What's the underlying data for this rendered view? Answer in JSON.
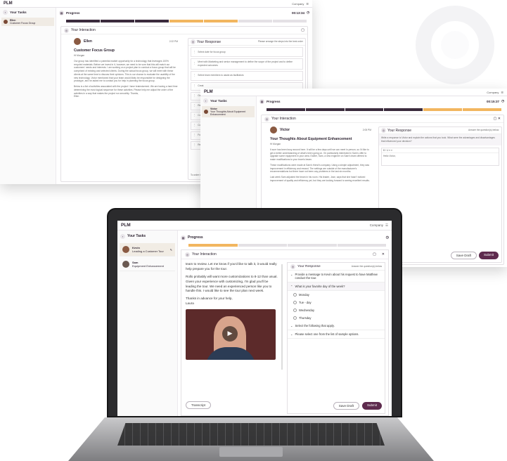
{
  "app_name": "PLM",
  "company_label": "Company",
  "colors": {
    "accent": "#5e2b4e",
    "progress_dark": "#3b2b3d",
    "progress_orange": "#f2b65f"
  },
  "win1": {
    "your_tasks": "Your Tasks",
    "task_name": "Ellen",
    "task_sub": "Customer Focus Group",
    "progress": "Progress",
    "timer": "00:13:34",
    "your_interaction": "Your Interaction",
    "sender": "Ellen",
    "time": "2:22 PM",
    "subject": "Customer Focus Group",
    "greeting": "Hi Morgan",
    "body1": "Our group has identified a potential market opportunity for a technology that leverages 100% recycled materials. Before we invest in it, however, we need to be sure that this will match our customers' needs and interests. I am working on a project plan to conduct a focus group that will be comprised of existing and selected clients. During the actual focus group, we will meet with these clients at the same time to discuss their opinions. This is our chance to evaluate the usability of the new technology. Victor mentioned that your team would likely be responsible for designing the prototype, and he asked me to contact you for help in planning the focus group.",
    "body2": "Below is a list of activities associated with the project I have brainstormed. We are having a hard time determining the most logical sequence for these activities. Please help me adjust the order of the activities in a way that makes the project run smoothly. Thanks,",
    "signoff": "Ellen",
    "your_response": "Your Response",
    "response_hint": "Please arrange the steps into the best order",
    "steps": [
      "Select date for focus group",
      "Meet with Marketing and senior management to define the scope of the project and to define expected outcomes",
      "Select team members to assist as facilitators",
      "Creat",
      "Gene",
      "Revie",
      "Condi",
      "Condi",
      "Follow",
      "Revie"
    ],
    "footer_note": "To order them bu"
  },
  "win2": {
    "your_tasks": "Your Tasks",
    "task_name": "Victor",
    "task_sub": "Your Thoughts About Equipment Enhancement",
    "progress": "Progress",
    "timer": "00:15:37",
    "your_interaction": "Your Interaction",
    "sender": "Victor",
    "time": "2:05 PM",
    "subject": "Your Thoughts About Equipment Enhancement",
    "greeting": "Hi Morgan",
    "body1": "It sure has been busy around here. It will be a few days until we can meet in person, so I'd like to get a better understanding of what's been going on. I'm particularly interested in Sam's offer to upgrade some equipment in your area. Earlier, Sam, a new engineer on Sam's team offered to make modifications to your team's beam.",
    "body2": "These modifications were made at Sam's friend's company. Using a simple adjustment, they saw improvement in efficiency and reward. The settings are outside of the manufacturer's recommendations but there have not been any problems in the last six months.",
    "body3": "Last week Sam adjusted the beam in his room. His leader, Jose, says that she hasn't noticed improvement of quality and efficiency yet, but they are looking forward to seeing excellent results.",
    "your_response": "Your Response",
    "response_hint": "Answer the question(s) below.",
    "question": "Write a response to Victor and explain the actions that you took. What were the advantages and disadvantages that influenced your decision?",
    "editor_text": "Hello Victor,",
    "save_draft": "Save Draft",
    "submit": "Submit"
  },
  "win3": {
    "your_tasks": "Your Tasks",
    "tasks": [
      {
        "name": "Kevin",
        "sub": "Leading a Customer Tour"
      },
      {
        "name": "Sam",
        "sub": "Equipment Enhancement"
      }
    ],
    "progress": "Progress",
    "your_interaction": "Your Interaction",
    "msg_top": "team to review. Let me know if you'd like to talk it, it would really help prepare you for the tour.",
    "msg_body": "Rollo probably will want more customizations to 8-12 than usual. Given your experience with customizing, I'm glad you'll be leading the tour. We need an experienced person like you to handle this. I would like to see the tour plan next week.",
    "msg_thanks": "Thanks in advance for your help,",
    "msg_sign": "Laura",
    "transcript": "Transcript",
    "your_response": "Your Response",
    "response_hint": "Answer the question(s) below",
    "q1": "Provide a message to Kevin about his request to have Matthew conduct the tour.",
    "q2": "What is your favorite day of the week?",
    "options": [
      "Monday",
      "Tue - day",
      "Wednesday",
      "Thursday"
    ],
    "q3": "Select the following that apply.",
    "q4": "Please select one from the list of sample options.",
    "save_draft": "Save Draft",
    "submit": "Submit"
  }
}
